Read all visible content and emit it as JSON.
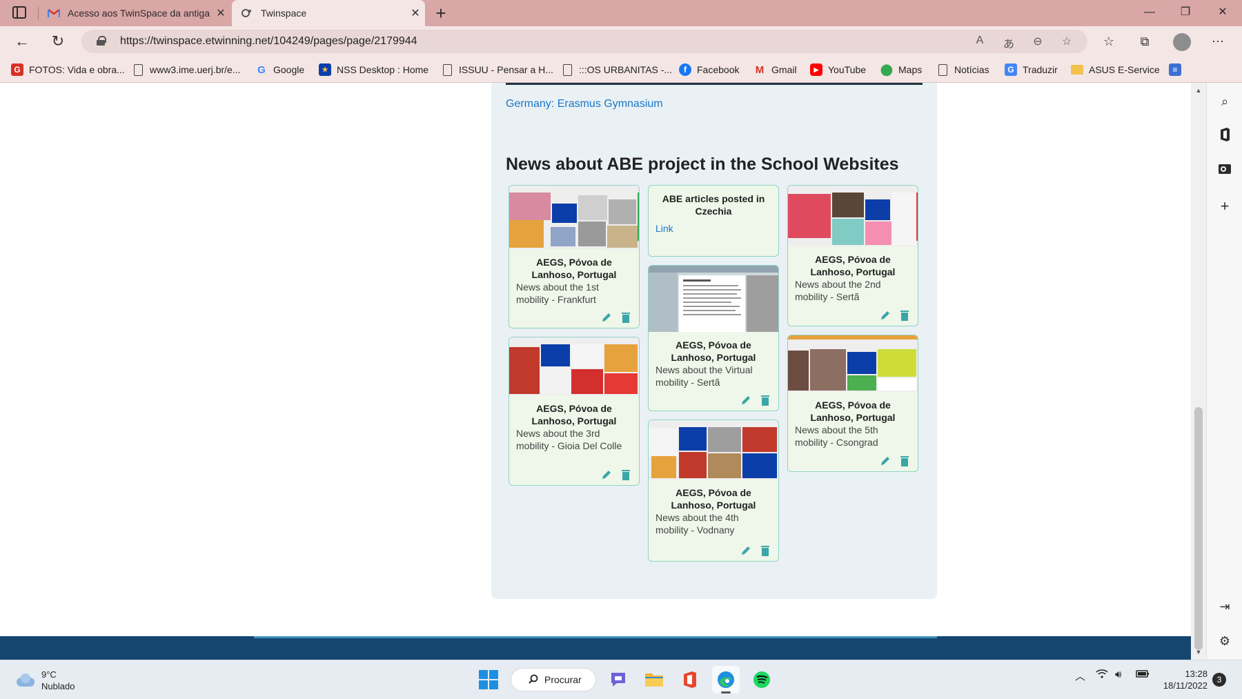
{
  "browser": {
    "tabs": [
      {
        "title": "Acesso aos TwinSpace da antiga",
        "favicon": "gmail-icon",
        "active": false
      },
      {
        "title": "Twinspace",
        "favicon": "twinspace-icon",
        "active": true
      }
    ],
    "url": "https://twinspace.etwinning.net/104249/pages/page/2179944",
    "bookmarks": [
      {
        "label": "FOTOS: Vida e obra...",
        "icon": "photos-icon"
      },
      {
        "label": "www3.ime.uerj.br/e...",
        "icon": "page-icon"
      },
      {
        "label": "Google",
        "icon": "google-icon"
      },
      {
        "label": "NSS Desktop : Home",
        "icon": "eu-flag-icon"
      },
      {
        "label": "ISSUU - Pensar a H...",
        "icon": "page-icon"
      },
      {
        "label": ":::OS URBANITAS -...",
        "icon": "page-icon"
      },
      {
        "label": "Facebook",
        "icon": "facebook-icon"
      },
      {
        "label": "Gmail",
        "icon": "gmail-icon"
      },
      {
        "label": "YouTube",
        "icon": "youtube-icon"
      },
      {
        "label": "Maps",
        "icon": "maps-icon"
      },
      {
        "label": "Notícias",
        "icon": "page-icon"
      },
      {
        "label": "Traduzir",
        "icon": "translate-icon"
      },
      {
        "label": "ASUS E-Service",
        "icon": "folder-icon"
      }
    ]
  },
  "page": {
    "country_link": "Germany: Erasmus Gymnasium",
    "section_title": "News about ABE project in the School Websites",
    "cards": [
      {
        "title": "AEGS, Póvoa de Lanhoso, Portugal",
        "description": "News about the 1st mobility - Frankfurt"
      },
      {
        "title": "AEGS, Póvoa de Lanhoso, Portugal",
        "description": "News about the 3rd mobility - Gioia Del Colle"
      },
      {
        "title": "ABE articles posted in Czechia",
        "link": "Link"
      },
      {
        "title": "AEGS, Póvoa de Lanhoso, Portugal",
        "description": "News about the Virtual mobility - Sertã"
      },
      {
        "title": "AEGS, Póvoa de Lanhoso, Portugal",
        "description": "News about the 4th mobility - Vodnany"
      },
      {
        "title": "AEGS, Póvoa de Lanhoso, Portugal",
        "description": "News about the 2nd mobility - Sertã"
      },
      {
        "title": "AEGS, Póvoa de Lanhoso, Portugal",
        "description": "News about the 5th mobility - Csongrad"
      }
    ]
  },
  "taskbar": {
    "weather_temp": "9°C",
    "weather_desc": "Nublado",
    "search_label": "Procurar",
    "time": "13:28",
    "date": "18/11/2022",
    "notifications": "3"
  },
  "colors": {
    "card_border": "#8fd3c7",
    "card_bg": "#eef7e9",
    "panel_bg": "#eaf1f4",
    "link": "#1976c7",
    "edit_icon": "#3aa6a8",
    "footer_bar": "#14466f",
    "tab_bar": "#d9a7a6"
  }
}
